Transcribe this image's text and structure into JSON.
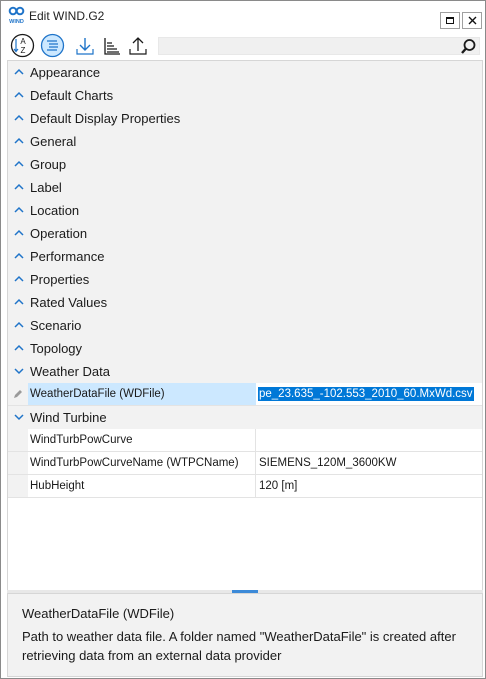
{
  "window": {
    "title": "Edit WIND.G2",
    "logo_text": "WIND"
  },
  "toolbar": {
    "buttons": [
      {
        "name": "sort-alphabetical-icon",
        "tooltip": ""
      },
      {
        "name": "sort-categorized-icon",
        "tooltip": ""
      },
      {
        "name": "download-icon",
        "tooltip": ""
      },
      {
        "name": "chart-icon",
        "tooltip": ""
      },
      {
        "name": "upload-icon",
        "tooltip": ""
      }
    ],
    "search": {
      "value": "",
      "placeholder": ""
    }
  },
  "categories": [
    {
      "label": "Appearance",
      "expanded": false
    },
    {
      "label": "Default Charts",
      "expanded": false
    },
    {
      "label": "Default Display Properties",
      "expanded": false
    },
    {
      "label": "General",
      "expanded": false
    },
    {
      "label": "Group",
      "expanded": false
    },
    {
      "label": "Label",
      "expanded": false
    },
    {
      "label": "Location",
      "expanded": false
    },
    {
      "label": "Operation",
      "expanded": false
    },
    {
      "label": "Performance",
      "expanded": false
    },
    {
      "label": "Properties",
      "expanded": false
    },
    {
      "label": "Rated Values",
      "expanded": false
    },
    {
      "label": "Scenario",
      "expanded": false
    },
    {
      "label": "Topology",
      "expanded": false
    },
    {
      "label": "Weather Data",
      "expanded": true,
      "properties": [
        {
          "name": "WeatherDataFile (WDFile)",
          "value": "pe_23.635_-102.553_2010_60.MxWd.csv",
          "selected": true
        }
      ]
    },
    {
      "label": "Wind Turbine",
      "expanded": true,
      "properties": [
        {
          "name": "WindTurbPowCurve",
          "value": ""
        },
        {
          "name": "WindTurbPowCurveName (WTPCName)",
          "value": "SIEMENS_120M_3600KW"
        },
        {
          "name": "HubHeight",
          "value": "120 [m]"
        }
      ]
    }
  ],
  "description": {
    "title": "WeatherDataFile (WDFile)",
    "text": "Path to weather data file. A folder named \"WeatherDataFile\" is created after retrieving data from an external data provider"
  },
  "colors": {
    "accent": "#0078d7",
    "selected_name_bg": "#cce8ff",
    "icon_blue": "#1f74c9",
    "category_bg": "#f2f2f2"
  }
}
